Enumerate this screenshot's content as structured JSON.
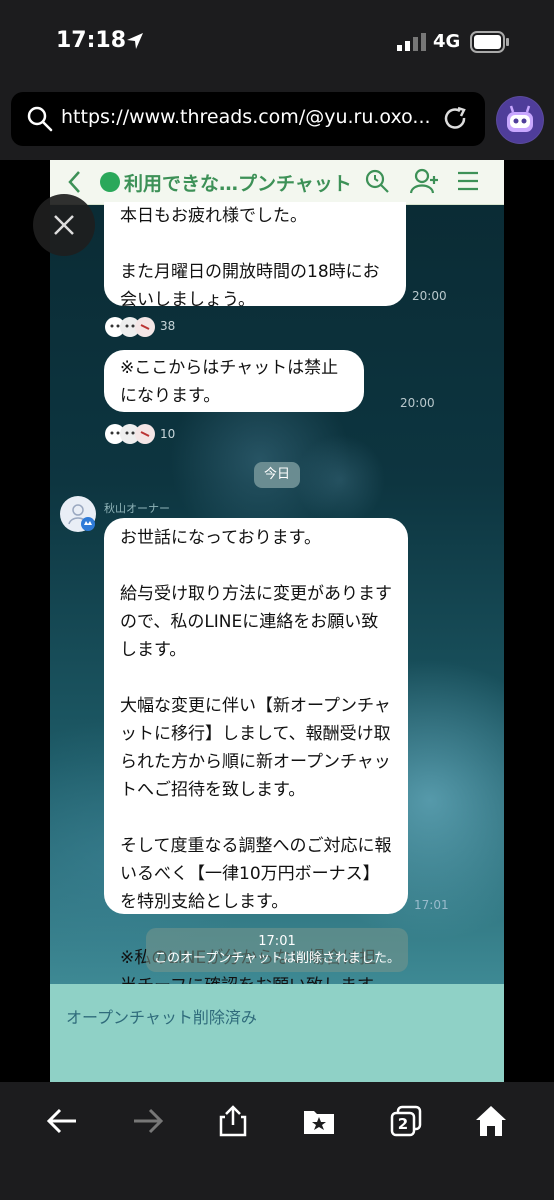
{
  "status_bar": {
    "time": "17:18",
    "network": "4G"
  },
  "browser": {
    "url": "https://www.threads.com/@yu.ru.oxo..."
  },
  "chat": {
    "title": "利用できな…プンチャット",
    "messages": [
      {
        "text": "本日もお疲れ様でした。\n\nまた月曜日の開放時間の18時にお会いしましょう。",
        "time": "20:00",
        "reaction_count": "38"
      },
      {
        "text": "※ここからはチャットは禁止になります。",
        "time": "20:00",
        "reaction_count": "10"
      }
    ],
    "date_label": "今日",
    "sender_name": "秋山オーナー",
    "owner_message": "お世話になっております。\n\n給与受け取り方法に変更がありますので、私のLINEに連絡をお願い致します。\n\n大幅な変更に伴い【新オープンチャットに移行】しまして、報酬受け取られた方から順に新オープンチャットへご招待を致します。\n\nそして度重なる調整へのご対応に報いるべく【一律10万円ボーナス】を特別支給とします。\n\n※私のLINEが分からない場合は担当チーフに確認をお願い致します。",
    "owner_message_time": "17:01",
    "system_time": "17:01",
    "system_text": "このオープンチャットは削除されました。",
    "footer_text": "オープンチャット削除済み"
  },
  "toolbar": {
    "tabs_count": "2"
  },
  "colors": {
    "header_bg": "#f3f7ef",
    "title_green": "#3d9157",
    "footer_bg": "#8fd1c6"
  }
}
